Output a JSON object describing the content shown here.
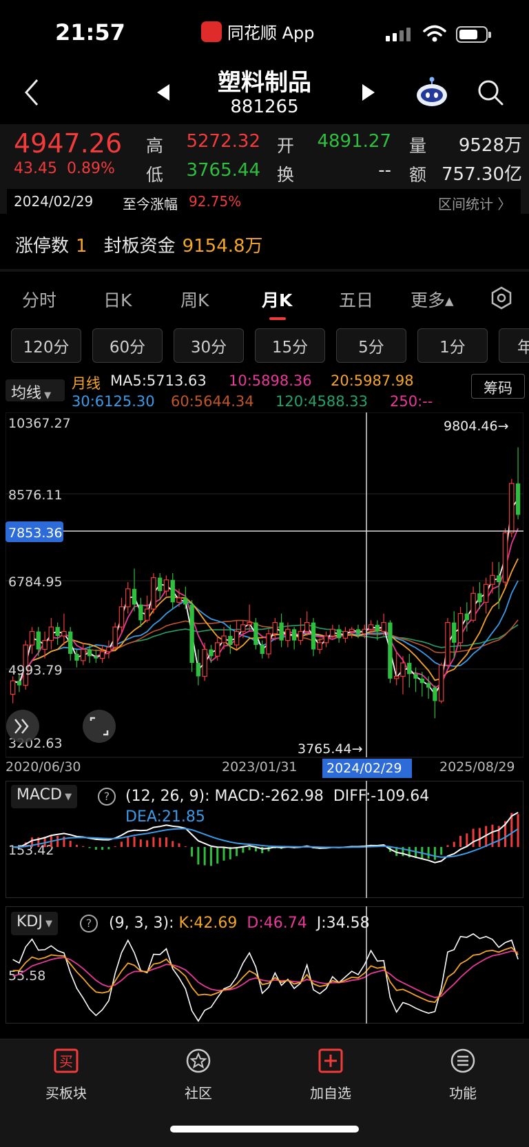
{
  "status": {
    "time": "21:57",
    "app_name": "同花顺 App"
  },
  "header": {
    "title": "塑料制品",
    "code": "881265"
  },
  "quote": {
    "price": "4947.26",
    "change": "43.45",
    "change_pct": "0.89%",
    "high_label": "高",
    "high": "5272.32",
    "low_label": "低",
    "low": "3765.44",
    "open_label": "开",
    "open": "4891.27",
    "turnover_label": "换",
    "turnover": "--",
    "volume_label": "量",
    "volume": "9528万",
    "amount_label": "额",
    "amount": "757.30亿",
    "date": "2024/02/29",
    "since_label": "至今涨幅",
    "since_value": "92.75%",
    "interval_label": "区间统计 〉"
  },
  "limit": {
    "count_label": "涨停数",
    "count": "1",
    "funds_label": "封板资金",
    "funds": "9154.8万"
  },
  "tabs": [
    "分时",
    "日K",
    "周K",
    "月K",
    "五日",
    "更多▴"
  ],
  "active_tab": "月K",
  "periods": [
    "120分",
    "60分",
    "30分",
    "15分",
    "5分",
    "1分",
    "年"
  ],
  "ma": {
    "selector": "均线",
    "period_label": "月线",
    "ma5": "MA5:5713.63",
    "ma10": "10:5898.36",
    "ma20": "20:5987.98",
    "ma30": "30:6125.30",
    "ma60": "60:5644.34",
    "ma120": "120:4588.33",
    "ma250": "250:--",
    "chips": "筹码"
  },
  "colors": {
    "up": "#f23b3b",
    "down": "#2fbf3f",
    "ma5": "#ffffff",
    "ma10": "#e8399a",
    "ma20": "#f5a623",
    "ma30": "#3a9be8",
    "ma60": "#c0562a",
    "ma120": "#25a36b",
    "accent_blue": "#2c6bd8"
  },
  "chart_data": {
    "type": "candlestick",
    "y_ticks": [
      "10367.27",
      "8576.11",
      "6784.95",
      "4993.79",
      "3202.63"
    ],
    "crosshair_value": "7853.36",
    "max_label": "9804.46→",
    "min_label": "3765.44→",
    "x_ticks": [
      "2020/06/30",
      "2023/01/31",
      "2025/08/29"
    ],
    "crosshair_date": "2024/02/29",
    "candles": [
      [
        4300,
        4600,
        4100,
        4700
      ],
      [
        4600,
        4500,
        4350,
        4750
      ],
      [
        4500,
        5400,
        4400,
        5500
      ],
      [
        5400,
        5700,
        5200,
        5800
      ],
      [
        5700,
        5300,
        5150,
        5800
      ],
      [
        5300,
        5500,
        5100,
        5700
      ],
      [
        5500,
        5800,
        5300,
        6000
      ],
      [
        5800,
        5600,
        5400,
        5900
      ],
      [
        5600,
        5700,
        5400,
        6100
      ],
      [
        5700,
        5200,
        5050,
        5800
      ],
      [
        5200,
        5050,
        4900,
        5300
      ],
      [
        5050,
        5300,
        4950,
        5450
      ],
      [
        5300,
        5150,
        5000,
        5400
      ],
      [
        5150,
        5100,
        5000,
        5300
      ],
      [
        5100,
        5250,
        5000,
        5400
      ],
      [
        5250,
        5350,
        5100,
        5500
      ],
      [
        5350,
        5800,
        5300,
        5900
      ],
      [
        5800,
        6250,
        5650,
        6450
      ],
      [
        6250,
        6650,
        6100,
        6800
      ],
      [
        6650,
        6300,
        6150,
        7100
      ],
      [
        6300,
        5950,
        5800,
        6450
      ],
      [
        5950,
        6200,
        5900,
        6500
      ],
      [
        6200,
        6900,
        6100,
        7000
      ],
      [
        6900,
        6600,
        6400,
        7000
      ],
      [
        6600,
        6850,
        6500,
        6950
      ],
      [
        6850,
        6350,
        6200,
        7000
      ],
      [
        6350,
        6450,
        6250,
        6650
      ],
      [
        6450,
        6300,
        6200,
        6700
      ],
      [
        6300,
        5000,
        4800,
        6400
      ],
      [
        5000,
        4700,
        4500,
        5300
      ],
      [
        4700,
        5300,
        4600,
        5450
      ],
      [
        5300,
        5150,
        5000,
        5400
      ],
      [
        5150,
        5450,
        5050,
        5600
      ],
      [
        5450,
        5600,
        5300,
        5800
      ],
      [
        5600,
        5400,
        5200,
        5850
      ],
      [
        5400,
        5700,
        5300,
        5950
      ],
      [
        5700,
        5850,
        5550,
        5950
      ],
      [
        5850,
        5900,
        5700,
        6300
      ],
      [
        5900,
        5400,
        5300,
        6000
      ],
      [
        5400,
        5200,
        5100,
        5500
      ],
      [
        5200,
        5650,
        5100,
        5750
      ],
      [
        5650,
        5900,
        5500,
        6000
      ],
      [
        5900,
        5500,
        5350,
        6100
      ],
      [
        5500,
        5750,
        5350,
        5900
      ],
      [
        5750,
        5500,
        5300,
        5800
      ],
      [
        5500,
        5700,
        5400,
        6000
      ],
      [
        5700,
        5900,
        5600,
        6150
      ],
      [
        5900,
        5300,
        5150,
        6000
      ],
      [
        5300,
        5450,
        5200,
        5550
      ],
      [
        5450,
        5600,
        5350,
        5700
      ],
      [
        5600,
        5750,
        5550,
        5850
      ],
      [
        5750,
        5550,
        5450,
        5850
      ],
      [
        5550,
        5700,
        5450,
        5800
      ],
      [
        5700,
        5750,
        5550,
        5800
      ],
      [
        5750,
        5650,
        5550,
        5850
      ],
      [
        5650,
        5750,
        5550,
        5850
      ],
      [
        5750,
        5850,
        5650,
        5950
      ],
      [
        5850,
        5700,
        5500,
        5950
      ],
      [
        5700,
        5900,
        5600,
        6100
      ],
      [
        5900,
        4650,
        4550,
        5950
      ],
      [
        4650,
        4700,
        4500,
        5250
      ],
      [
        4700,
        5000,
        4300,
        5150
      ],
      [
        5000,
        4750,
        4450,
        5200
      ],
      [
        4750,
        4650,
        4350,
        4900
      ],
      [
        4650,
        4550,
        4250,
        4800
      ],
      [
        4550,
        4450,
        4200,
        4700
      ],
      [
        4450,
        4150,
        3765,
        4500
      ],
      [
        4150,
        4950,
        4100,
        5000
      ],
      [
        4950,
        5900,
        4900,
        6000
      ],
      [
        5900,
        5450,
        5100,
        6150
      ],
      [
        5450,
        6100,
        5300,
        6250
      ],
      [
        6100,
        5950,
        5700,
        6350
      ],
      [
        5950,
        6550,
        5900,
        6700
      ],
      [
        6550,
        6350,
        6200,
        6800
      ],
      [
        6350,
        6750,
        6100,
        6900
      ],
      [
        6750,
        6950,
        6550,
        7250
      ],
      [
        6950,
        6800,
        6200,
        7250
      ],
      [
        6800,
        7900,
        6700,
        8000
      ],
      [
        7900,
        9000,
        7800,
        9100
      ],
      [
        9000,
        8300,
        8200,
        9804
      ]
    ]
  },
  "macd": {
    "selector": "MACD",
    "params": "(12, 26, 9):",
    "macd": "MACD:-262.98",
    "diff": "DIFF:-109.64",
    "dea": "DEA:21.85",
    "tick": "153.42"
  },
  "kdj": {
    "selector": "KDJ",
    "params": "(9, 3, 3):",
    "k": "K:42.69",
    "d": "D:46.74",
    "j": "J:34.58",
    "tick": "55.58"
  },
  "bottom": [
    "买板块",
    "社区",
    "加自选",
    "功能"
  ]
}
